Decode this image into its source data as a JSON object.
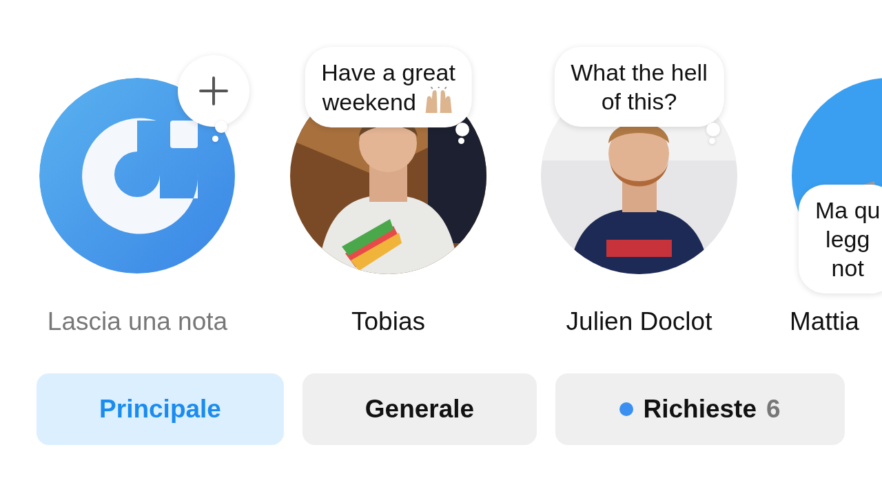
{
  "notes": [
    {
      "kind": "own",
      "name": "Lascia una nota"
    },
    {
      "kind": "friend",
      "name": "Tobias",
      "note_lines": [
        "Have a great",
        "weekend"
      ],
      "note_emoji": true
    },
    {
      "kind": "friend",
      "name": "Julien Doclot",
      "note_lines": [
        "What the hell",
        "of this?"
      ],
      "note_emoji": false
    },
    {
      "kind": "friend",
      "name": "Mattia",
      "note_lines": [
        "Ma qu",
        "legg",
        "not"
      ],
      "note_emoji": false
    }
  ],
  "tabs": [
    {
      "label": "Principale",
      "selected": true
    },
    {
      "label": "Generale",
      "selected": false
    },
    {
      "label": "Richieste",
      "selected": false,
      "dot": true,
      "count": "6"
    }
  ]
}
